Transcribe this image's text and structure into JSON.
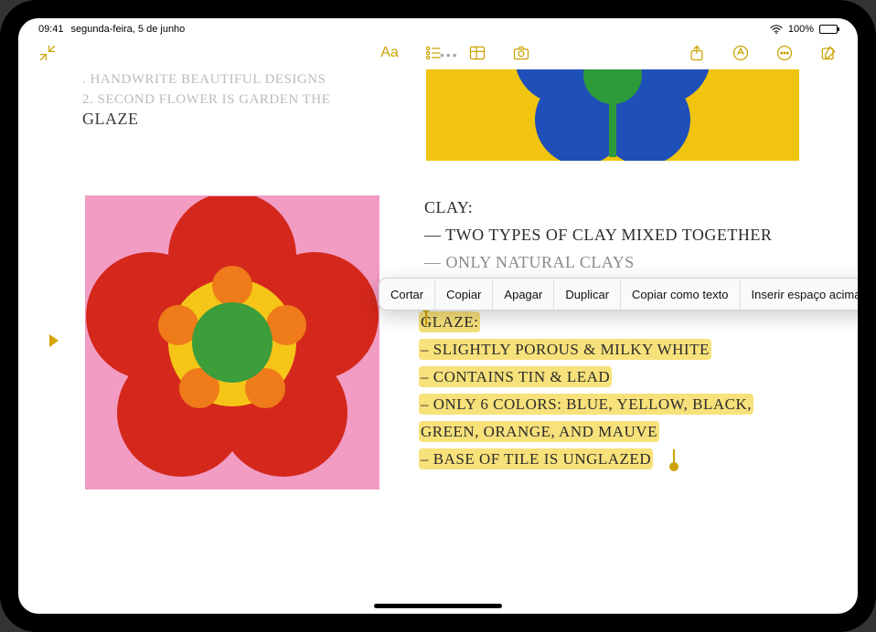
{
  "status": {
    "time": "09:41",
    "date": "segunda-feira, 5 de junho",
    "battery": "100%"
  },
  "toolbar": {
    "collapse": "collapse",
    "format": "Aa"
  },
  "note": {
    "top_faded_line1": ". HANDWRITE BEAUTIFUL DESIGNS",
    "top_faded_line2": "2. SECOND FLOWER IS GARDEN THE",
    "top_glaze": "GLAZE",
    "clay_heading": "CLAY:",
    "clay_line1": "— TWO TYPES OF CLAY MIXED TOGETHER",
    "clay_line2": "— ONLY NATURAL CLAYS",
    "glaze_heading": "GLAZE:",
    "glaze_l1": "– SLIGHTLY POROUS & MILKY WHITE",
    "glaze_l2": "– CONTAINS TIN & LEAD",
    "glaze_l3": "– ONLY 6 COLORS: BLUE, YELLOW, BLACK,",
    "glaze_l3b": "    GREEN, ORANGE, AND MAUVE",
    "glaze_l4": "– BASE OF TILE IS UNGLAZED"
  },
  "context_menu": {
    "items": [
      "Cortar",
      "Copiar",
      "Apagar",
      "Duplicar",
      "Copiar como texto",
      "Inserir espaço acima"
    ]
  }
}
